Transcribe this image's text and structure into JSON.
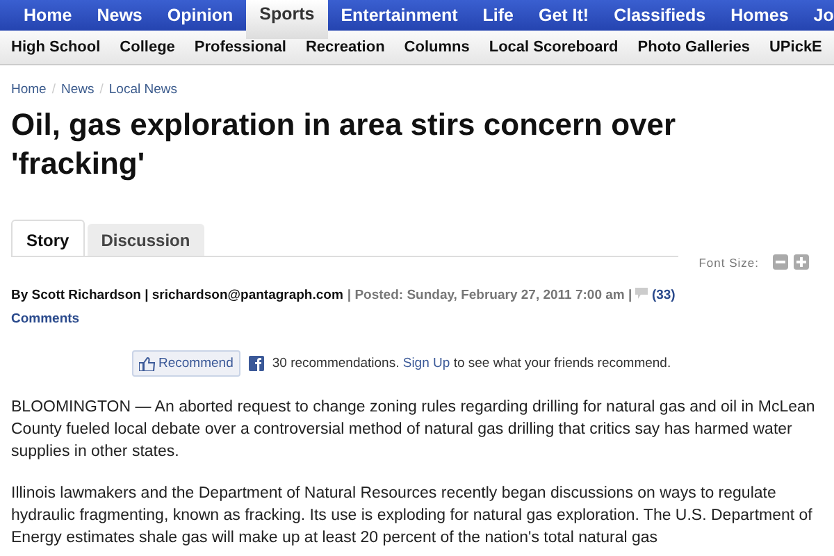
{
  "nav": [
    {
      "label": "Home",
      "selected": false
    },
    {
      "label": "News",
      "selected": false
    },
    {
      "label": "Opinion",
      "selected": false
    },
    {
      "label": "Sports",
      "selected": true
    },
    {
      "label": "Entertainment",
      "selected": false
    },
    {
      "label": "Life",
      "selected": false
    },
    {
      "label": "Get It!",
      "selected": false
    },
    {
      "label": "Classifieds",
      "selected": false
    },
    {
      "label": "Homes",
      "selected": false
    },
    {
      "label": "Jo",
      "selected": false
    }
  ],
  "subnav": [
    "High School",
    "College",
    "Professional",
    "Recreation",
    "Columns",
    "Local Scoreboard",
    "Photo Galleries",
    "UPickE"
  ],
  "breadcrumb": [
    "Home",
    "News",
    "Local News"
  ],
  "breadcrumb_separator": "/",
  "headline": "Oil, gas exploration in area stirs concern over 'fracking'",
  "tabs": [
    {
      "label": "Story",
      "selected": true
    },
    {
      "label": "Discussion",
      "selected": false
    }
  ],
  "font_size_label": "Font Size:",
  "byline": {
    "author": "By Scott Richardson | srichardson@pantagraph.com",
    "posted": "| Posted: Sunday, February 27, 2011 7:00 am |",
    "comments_count": "(33)",
    "comments_label": "Comments"
  },
  "recommend": {
    "button": "Recommend",
    "count_text": "30 recommendations.",
    "link": "Sign Up",
    "rest": "to see what your friends recommend."
  },
  "paragraphs": [
    "BLOOMINGTON — An aborted request to change zoning rules regarding drilling for natural gas and oil in McLean County fueled local debate over a controversial method of natural gas drilling that critics say has harmed water supplies in other states.",
    "Illinois lawmakers and the Department of Natural Resources recently began discussions on ways to regulate hydraulic fragmenting, known as fracking. Its use is exploding for natural gas exploration. The U.S. Department of Energy estimates shale gas will make up at least 20 percent of the nation's total natural gas"
  ]
}
